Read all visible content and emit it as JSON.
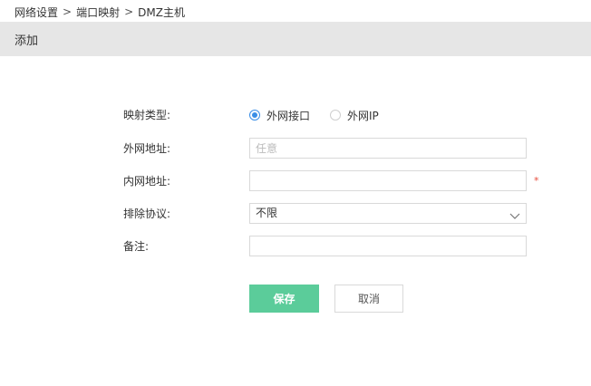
{
  "breadcrumb": {
    "items": [
      "网络设置",
      "端口映射",
      "DMZ主机"
    ],
    "separator": ">"
  },
  "header": {
    "title": "添加"
  },
  "form": {
    "mapping_type": {
      "label": "映射类型:",
      "options": [
        {
          "label": "外网接口",
          "checked": true
        },
        {
          "label": "外网IP",
          "checked": false
        }
      ]
    },
    "external_address": {
      "label": "外网地址:",
      "value": "",
      "placeholder": "任意"
    },
    "internal_address": {
      "label": "内网地址:",
      "value": "",
      "placeholder": "",
      "required_mark": "*"
    },
    "exclude_protocol": {
      "label": "排除协议:",
      "selected": "不限"
    },
    "remark": {
      "label": "备注:",
      "value": "",
      "placeholder": ""
    }
  },
  "buttons": {
    "save": "保存",
    "cancel": "取消"
  },
  "colors": {
    "accent": "#3a8ee6",
    "save_button": "#5bcc9a",
    "header_bg": "#e6e6e6",
    "required": "#e74c3c"
  },
  "icons": {
    "select_arrow": "chevron-down-icon"
  }
}
